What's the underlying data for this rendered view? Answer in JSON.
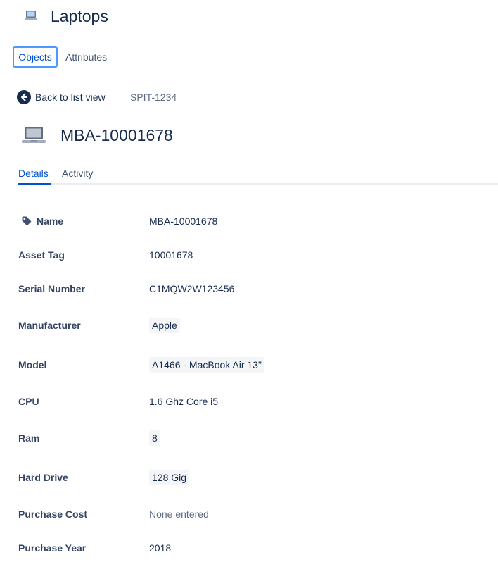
{
  "header": {
    "title": "Laptops",
    "icon": "laptop-icon"
  },
  "top_tabs": [
    {
      "label": "Objects",
      "selected": true
    },
    {
      "label": "Attributes",
      "selected": false
    }
  ],
  "nav": {
    "back_label": "Back to list view",
    "issue_key": "SPIT-1234"
  },
  "object": {
    "title": "MBA-10001678",
    "icon": "laptop-icon"
  },
  "sub_tabs": [
    {
      "label": "Details",
      "selected": true
    },
    {
      "label": "Activity",
      "selected": false
    }
  ],
  "attributes": [
    {
      "label": "Name",
      "value": "MBA-10001678",
      "style": "plain",
      "icon": "tag-icon"
    },
    {
      "label": "Asset Tag",
      "value": "10001678",
      "style": "plain"
    },
    {
      "label": "Serial Number",
      "value": "C1MQW2W123456",
      "style": "plain"
    },
    {
      "label": "Manufacturer",
      "value": "Apple",
      "style": "lozenge"
    },
    {
      "label": "Model",
      "value": "A1466 - MacBook Air 13\"",
      "style": "lozenge"
    },
    {
      "label": "CPU",
      "value": "1.6 Ghz Core i5",
      "style": "plain"
    },
    {
      "label": "Ram",
      "value": "8",
      "style": "lozenge"
    },
    {
      "label": "Hard Drive",
      "value": "128 Gig",
      "style": "lozenge"
    },
    {
      "label": "Purchase Cost",
      "value": "None entered",
      "style": "muted"
    },
    {
      "label": "Purchase Year",
      "value": "2018",
      "style": "plain"
    }
  ],
  "colors": {
    "accent": "#0052cc",
    "focus_ring": "#4c9aff",
    "text": "#172b4d",
    "lozenge_bg": "#f4f5f7"
  }
}
